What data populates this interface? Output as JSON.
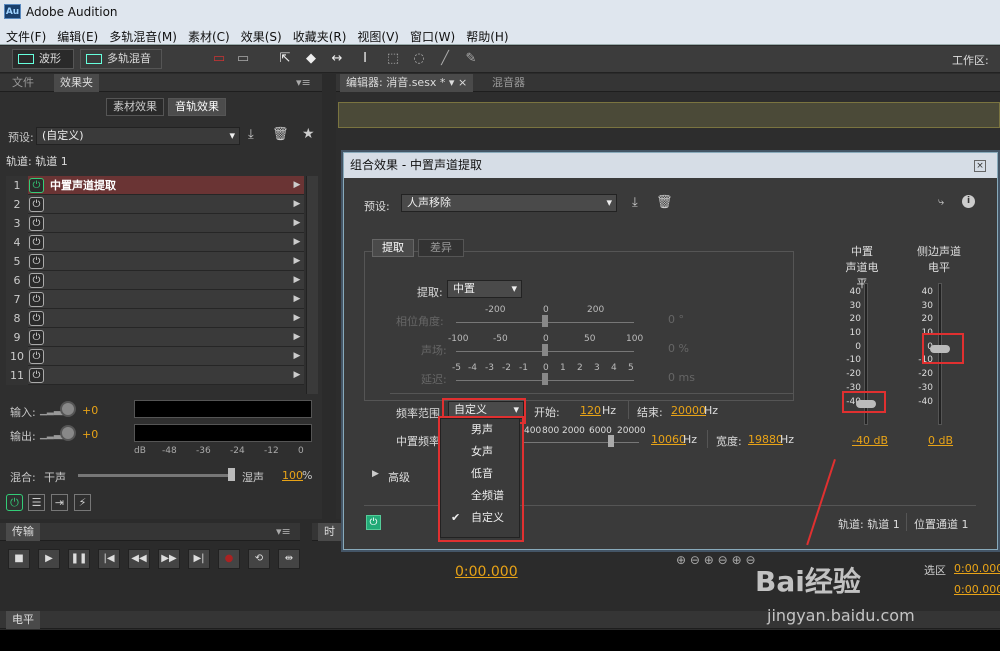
{
  "app": {
    "title": "Adobe Audition",
    "logo": "Au"
  },
  "menu": [
    "文件(F)",
    "编辑(E)",
    "多轨混音(M)",
    "素材(C)",
    "效果(S)",
    "收藏夹(R)",
    "视图(V)",
    "窗口(W)",
    "帮助(H)"
  ],
  "toolbar": {
    "waveform": "波形",
    "multitrack": "多轨混音",
    "workspace": "工作区:"
  },
  "left": {
    "tabs": [
      "文件",
      "效果夹"
    ],
    "btn_clip": "素材效果",
    "btn_track": "音轨效果",
    "preset_label": "预设:",
    "preset_value": "(自定义)",
    "track_label": "轨道: 轨道 1",
    "rows": [
      {
        "n": "1",
        "name": "中置声道提取"
      },
      {
        "n": "2",
        "name": ""
      },
      {
        "n": "3",
        "name": ""
      },
      {
        "n": "4",
        "name": ""
      },
      {
        "n": "5",
        "name": ""
      },
      {
        "n": "6",
        "name": ""
      },
      {
        "n": "7",
        "name": ""
      },
      {
        "n": "8",
        "name": ""
      },
      {
        "n": "9",
        "name": ""
      },
      {
        "n": "10",
        "name": ""
      },
      {
        "n": "11",
        "name": ""
      }
    ],
    "input_label": "输入:",
    "input_val": "+0",
    "output_label": "输出:",
    "output_val": "+0",
    "scale": [
      "dB",
      "-48",
      "-36",
      "-24",
      "-12",
      "0"
    ],
    "mix_label": "混合:",
    "mix_dry": "干声",
    "mix_wet": "湿声",
    "mix_val": "100",
    "mix_unit": "%"
  },
  "editor": {
    "tab1": "编辑器: 消音.sesx *",
    "tab2": "混音器"
  },
  "dialog": {
    "title": "组合效果 - 中置声道提取",
    "preset_label": "预设:",
    "preset_value": "人声移除",
    "tabs": [
      "提取",
      "差异"
    ],
    "extract_label": "提取:",
    "extract_value": "中置",
    "phase_label": "相位角度:",
    "phase_ticks": [
      "-200",
      "0",
      "200"
    ],
    "phase_val": "0 °",
    "pan_label": "声场:",
    "pan_ticks": [
      "-100",
      "-50",
      "0",
      "50",
      "100"
    ],
    "pan_val": "0 %",
    "delay_label": "延迟:",
    "delay_ticks": [
      "-5",
      "-4",
      "-3",
      "-2",
      "-1",
      "0",
      "1",
      "2",
      "3",
      "4",
      "5"
    ],
    "delay_val": "0 ms",
    "freq_label": "频率范围",
    "freq_value": "自定义",
    "start_label": "开始:",
    "start_val": "120",
    "start_unit": "Hz",
    "end_label": "结束:",
    "end_val": "20000",
    "end_unit": "Hz",
    "center_freq_label": "中置频率",
    "cf_ticks": [
      "400",
      "800",
      "2000",
      "6000",
      "20000"
    ],
    "cf_val": "10060",
    "cf_unit": "Hz",
    "width_label": "宽度:",
    "width_val": "19880",
    "width_unit": "Hz",
    "advanced": "高级",
    "center_level_title1": "中置",
    "center_level_title2": "声道电平",
    "side_level_title1": "侧边声道",
    "side_level_title2": "电平",
    "level_scale": [
      "40",
      "30",
      "20",
      "10",
      "0",
      "-10",
      "-20",
      "-30",
      "-40"
    ],
    "center_level_val": "-40 dB",
    "side_level_val": "0 dB",
    "status_track": "轨道: 轨道 1",
    "status_pos": "位置通道 1",
    "dropdown": [
      "男声",
      "女声",
      "低音",
      "全频谱",
      "自定义"
    ],
    "dropdown_selected": "自定义"
  },
  "transport": {
    "title": "传输",
    "time_title": "时",
    "time": "0:00.000"
  },
  "selection": {
    "label1": "选区",
    "val1": "0:00.000",
    "val2": "0:00.000"
  },
  "bottom": {
    "level_title": "电平"
  },
  "watermark": {
    "brand": "Bai经验",
    "url": "jingyan.baidu.com"
  }
}
